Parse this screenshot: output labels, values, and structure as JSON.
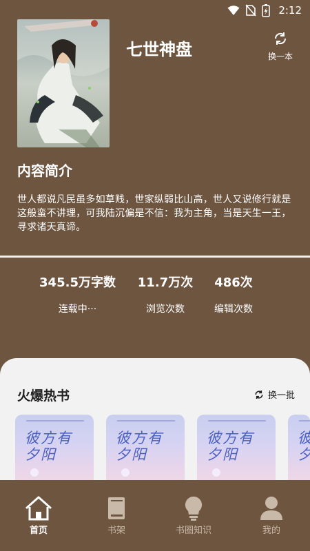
{
  "status": {
    "time": "2:12"
  },
  "book": {
    "title": "七世神盘",
    "swap_label": "换一本",
    "intro_heading": "内容简介",
    "intro_text": "世人都说凡民虽多如草贱，世家纵弱比山高，世人又说修行就是这般蛮不讲理，可我陆沉偏是不信：我为主角，当是天生一王，寻求诸天真谛。"
  },
  "stats": [
    {
      "value": "345.5万字数",
      "caption": "连载中···"
    },
    {
      "value": "11.7万次",
      "caption": "浏览次数"
    },
    {
      "value": "486次",
      "caption": "编辑次数"
    }
  ],
  "hot": {
    "title": "火爆热书",
    "swap_label": "换一批",
    "books": [
      {
        "cover_title": "彼方有夕阳"
      },
      {
        "cover_title": "彼方有夕阳"
      },
      {
        "cover_title": "彼方有夕阳"
      },
      {
        "cover_title": "彼方有夕阳"
      }
    ]
  },
  "nav": [
    {
      "label": "首页",
      "icon": "home-icon",
      "active": true
    },
    {
      "label": "书架",
      "icon": "bookshelf-icon",
      "active": false
    },
    {
      "label": "书圈知识",
      "icon": "lightbulb-icon",
      "active": false
    },
    {
      "label": "我的",
      "icon": "profile-icon",
      "active": false
    }
  ],
  "colors": {
    "background": "#6e5540",
    "panel": "#f2f2f2",
    "nav_inactive": "#c9b9a8"
  }
}
